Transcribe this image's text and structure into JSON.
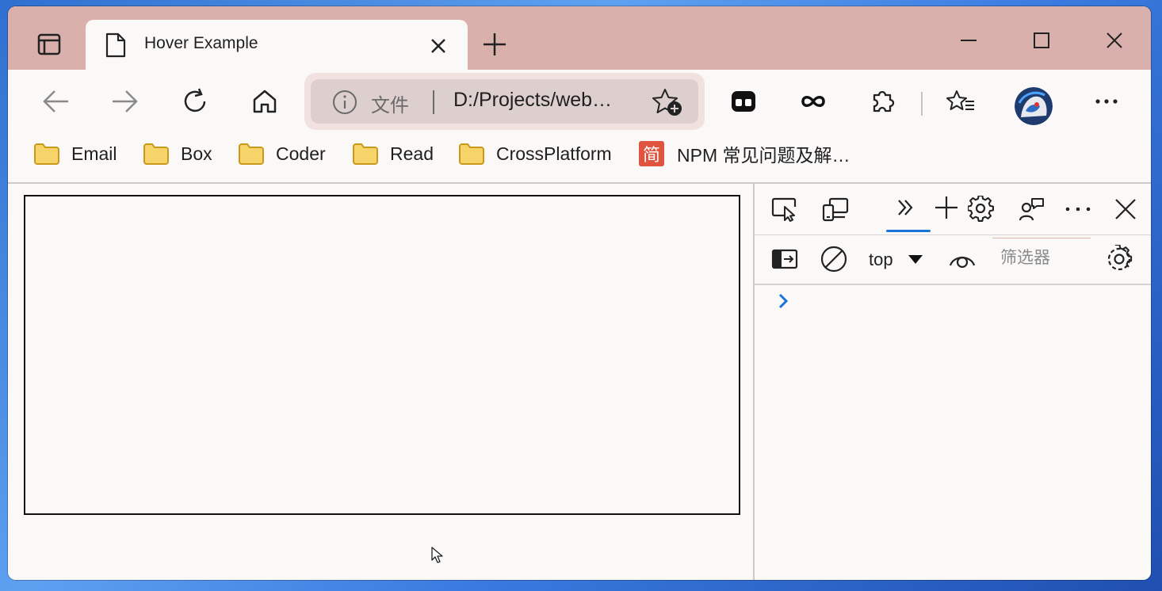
{
  "browser": {
    "tab": {
      "title": "Hover Example"
    },
    "address": {
      "scheme_label": "文件",
      "url": "D:/Projects/web…"
    }
  },
  "bookmarks": [
    {
      "label": "Email",
      "icon": "folder-icon"
    },
    {
      "label": "Box",
      "icon": "folder-icon"
    },
    {
      "label": "Coder",
      "icon": "folder-icon"
    },
    {
      "label": "Read",
      "icon": "folder-icon"
    },
    {
      "label": "CrossPlatform",
      "icon": "folder-icon"
    },
    {
      "label": "NPM 常见问题及解…",
      "icon": "jianshu-icon",
      "icon_text": "简"
    }
  ],
  "devtools": {
    "context": "top",
    "filter_placeholder": "筛选器"
  },
  "colors": {
    "titlebar": "#d9b0ab",
    "accent": "#1a73d6",
    "folder": "#f7d46a",
    "jianshu": "#e0533f"
  }
}
